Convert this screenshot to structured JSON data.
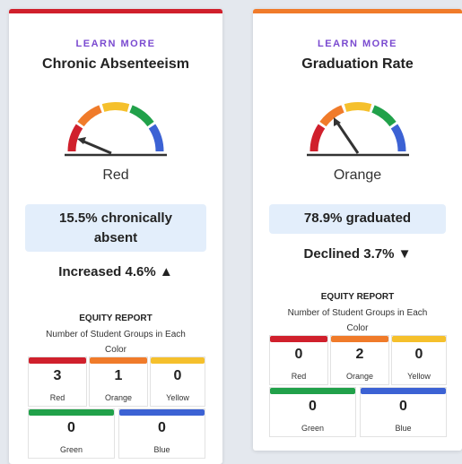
{
  "colors": {
    "red": "#d0202c",
    "orange": "#f07b2a",
    "yellow": "#f5c02c",
    "green": "#21a14a",
    "blue": "#3c62d4",
    "learn_more": "#7a4ad0",
    "value_box_bg": "#e3eefb"
  },
  "cards": [
    {
      "learn_more": "LEARN MORE",
      "title": "Chronic Absenteeism",
      "status_color_label": "Red",
      "gauge_level": "red",
      "value_line1": "15.5% chronically",
      "value_line2": "absent",
      "change_text": "Increased 4.6% ▲",
      "equity_title": "EQUITY REPORT",
      "equity_desc_line1": "Number of Student Groups in Each",
      "equity_desc_line2": "Color",
      "groups": [
        {
          "label": "Red",
          "count": "3"
        },
        {
          "label": "Orange",
          "count": "1"
        },
        {
          "label": "Yellow",
          "count": "0"
        },
        {
          "label": "Green",
          "count": "0"
        },
        {
          "label": "Blue",
          "count": "0"
        }
      ]
    },
    {
      "learn_more": "LEARN MORE",
      "title": "Graduation Rate",
      "status_color_label": "Orange",
      "gauge_level": "orange",
      "value_line1": "78.9% graduated",
      "change_text": "Declined 3.7% ▼",
      "equity_title": "EQUITY REPORT",
      "equity_desc_line1": "Number of Student Groups in Each",
      "equity_desc_line2": "Color",
      "groups": [
        {
          "label": "Red",
          "count": "0"
        },
        {
          "label": "Orange",
          "count": "2"
        },
        {
          "label": "Yellow",
          "count": "0"
        },
        {
          "label": "Green",
          "count": "0"
        },
        {
          "label": "Blue",
          "count": "0"
        }
      ]
    }
  ]
}
